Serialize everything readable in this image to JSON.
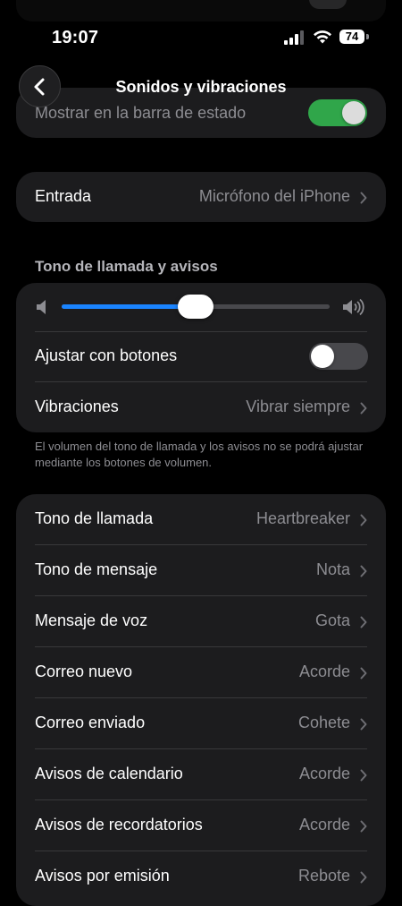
{
  "status_bar": {
    "time": "19:07",
    "battery": "74"
  },
  "header": {
    "title": "Sonidos y vibraciones"
  },
  "status_bar_row": {
    "label": "Mostrar en la barra de estado",
    "toggle_on": true
  },
  "input_row": {
    "label": "Entrada",
    "value": "Micrófono del iPhone"
  },
  "ringtone_section": {
    "header": "Tono de llamada y avisos",
    "volume_level": 0.5,
    "adjust_with_buttons": {
      "label": "Ajustar con botones",
      "toggle_on": false
    },
    "vibrations": {
      "label": "Vibraciones",
      "value": "Vibrar siempre"
    },
    "footnote": "El volumen del tono de llamada y los avisos no se podrá ajustar mediante los botones de volumen."
  },
  "sounds_list": [
    {
      "label": "Tono de llamada",
      "value": "Heartbreaker"
    },
    {
      "label": "Tono de mensaje",
      "value": "Nota"
    },
    {
      "label": "Mensaje de voz",
      "value": "Gota"
    },
    {
      "label": "Correo nuevo",
      "value": "Acorde"
    },
    {
      "label": "Correo enviado",
      "value": "Cohete"
    },
    {
      "label": "Avisos de calendario",
      "value": "Acorde"
    },
    {
      "label": "Avisos de recordatorios",
      "value": "Acorde"
    },
    {
      "label": "Avisos por emisión",
      "value": "Rebote"
    }
  ],
  "colors": {
    "toggle_on": "#30a64a",
    "slider_fill": "#1a84ff",
    "card": "#1c1c1e"
  }
}
